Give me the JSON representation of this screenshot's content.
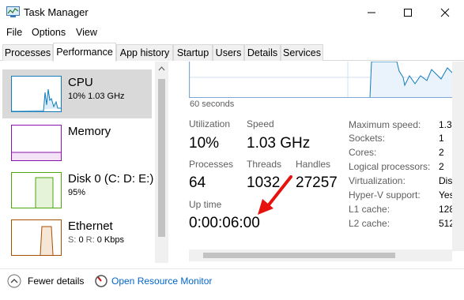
{
  "window": {
    "title": "Task Manager"
  },
  "menu": [
    "File",
    "Options",
    "View"
  ],
  "tabs": [
    "Processes",
    "Performance",
    "App history",
    "Startup",
    "Users",
    "Details",
    "Services"
  ],
  "active_tab": "Performance",
  "resources": [
    {
      "name": "CPU",
      "sub": "10% 1.03 GHz",
      "accent": "#117dbb"
    },
    {
      "name": "Memory",
      "sub": "",
      "accent": "#8b12ae"
    },
    {
      "name": "Disk 0 (C: D: E:)",
      "sub": "95%",
      "accent": "#4da60c"
    },
    {
      "name": "Ethernet",
      "sub_label1": "S:",
      "sub_val1": "0",
      "sub_label2": "R:",
      "sub_val2": "0 Kbps",
      "accent": "#a74f01"
    }
  ],
  "graph": {
    "time_label": "60 seconds"
  },
  "stats": {
    "utilization_label": "Utilization",
    "utilization_value": "10%",
    "speed_label": "Speed",
    "speed_value": "1.03 GHz",
    "processes_label": "Processes",
    "processes_value": "64",
    "threads_label": "Threads",
    "threads_value": "1032",
    "handles_label": "Handles",
    "handles_value": "27257",
    "uptime_label": "Up time",
    "uptime_value": "0:00:06:00"
  },
  "specs": [
    {
      "label": "Maximum speed:",
      "value": "1.3"
    },
    {
      "label": "Sockets:",
      "value": "1"
    },
    {
      "label": "Cores:",
      "value": "2"
    },
    {
      "label": "Logical processors:",
      "value": "2"
    },
    {
      "label": "Virtualization:",
      "value": "Dis"
    },
    {
      "label": "Hyper-V support:",
      "value": "Yes"
    },
    {
      "label": "L1 cache:",
      "value": "128"
    },
    {
      "label": "L2 cache:",
      "value": "512"
    }
  ],
  "footer": {
    "fewer_details": "Fewer details",
    "resource_monitor": "Open Resource Monitor"
  },
  "colors": {
    "annotation_arrow": "#e8120c",
    "link": "#0066cc"
  }
}
